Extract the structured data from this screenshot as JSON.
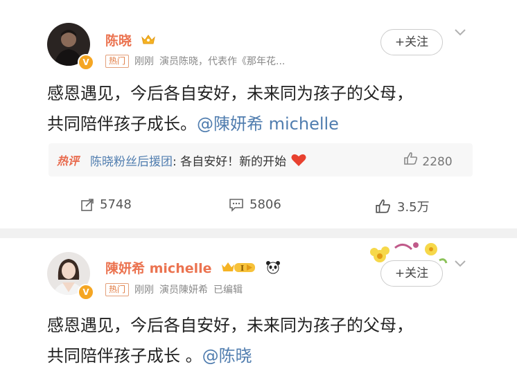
{
  "posts": [
    {
      "author": "陈晓",
      "hot_tag": "热门",
      "time": "刚刚",
      "bio": "演员陈晓，代表作《那年花...",
      "follow_label": "+关注",
      "content_line1": "感恩遇见，今后各自安好，未来同为孩子的父母，",
      "content_line2_prefix": "共同陪伴孩子成长。",
      "mention": "@陳妍希 michelle",
      "hot_comment": {
        "tag": "热评",
        "user": "陈晓粉丝后援团",
        "text": ": 各自安好！新的开始",
        "likes": "2280"
      },
      "actions": {
        "repost": "5748",
        "comment": "5806",
        "like": "3.5万"
      }
    },
    {
      "author": "陳妍希 michelle",
      "hot_tag": "热门",
      "time": "刚刚",
      "bio": "演员陳妍希",
      "edited": "已编辑",
      "follow_label": "+关注",
      "content_line1": "感恩遇见，今后各自安好，未来同为孩子的父母，",
      "content_line2_prefix": "共同陪伴孩子成长 。",
      "mention": "@陈晓"
    }
  ],
  "colors": {
    "name": "#eb7350",
    "mention": "#507daf",
    "hot": "#e86a4d",
    "verified": "#f5a623"
  },
  "icons": [
    "crown-icon",
    "verified-icon",
    "chevron-down-icon",
    "thumb-up-icon",
    "repost-icon",
    "comment-icon",
    "heart-icon",
    "panda-icon",
    "vip-level-icon"
  ]
}
